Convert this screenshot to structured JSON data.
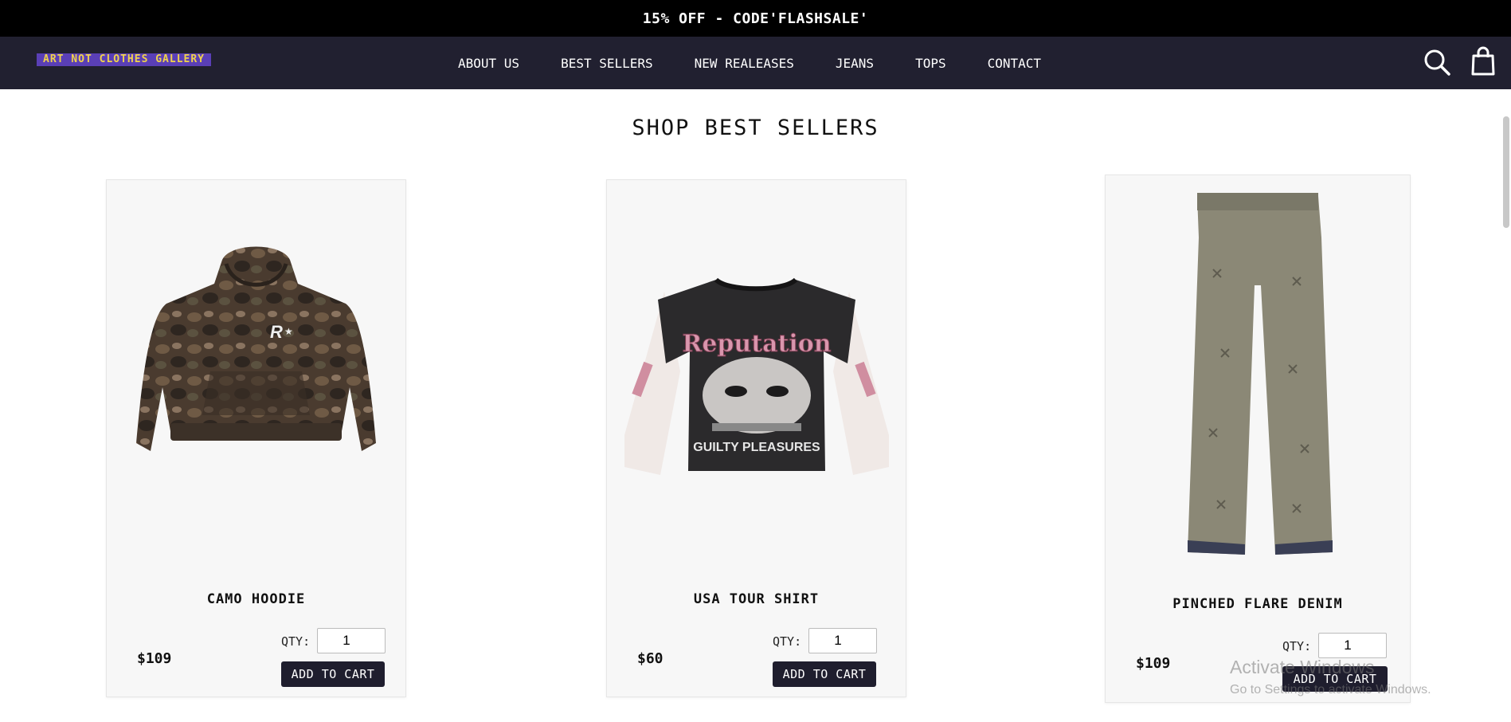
{
  "promo": {
    "text": "15% OFF - CODE'FLASHSALE'"
  },
  "header": {
    "logo": "ART NOT CLOTHES GALLERY",
    "menu": [
      "ABOUT US",
      "BEST SELLERS",
      "NEW REALEASES",
      "JEANS",
      "TOPS",
      "CONTACT"
    ],
    "icons": [
      "search-icon",
      "shopping-bag-icon"
    ]
  },
  "main": {
    "heading": "SHOP BEST SELLERS",
    "products": [
      {
        "name": "CAMO HOODIE",
        "price": "$109",
        "qty_label": "QTY:",
        "qty": "1",
        "button": "ADD TO CART",
        "image": "camo-hoodie-image"
      },
      {
        "name": "USA TOUR SHIRT",
        "price": "$60",
        "qty_label": "QTY:",
        "qty": "1",
        "button": "ADD TO CART",
        "image": "tour-shirt-image"
      },
      {
        "name": "PINCHED FLARE DENIM",
        "price": "$109",
        "qty_label": "QTY:",
        "qty": "1",
        "button": "ADD TO CART",
        "image": "flare-denim-image"
      }
    ]
  },
  "os_watermark": {
    "line1": "Activate Windows",
    "line2": "Go to Settings to activate Windows."
  },
  "colors": {
    "nav_bg": "#212030",
    "logo_bg": "#5a3fb6",
    "logo_text": "#f0d34a",
    "button_bg": "#1f1e2e"
  }
}
